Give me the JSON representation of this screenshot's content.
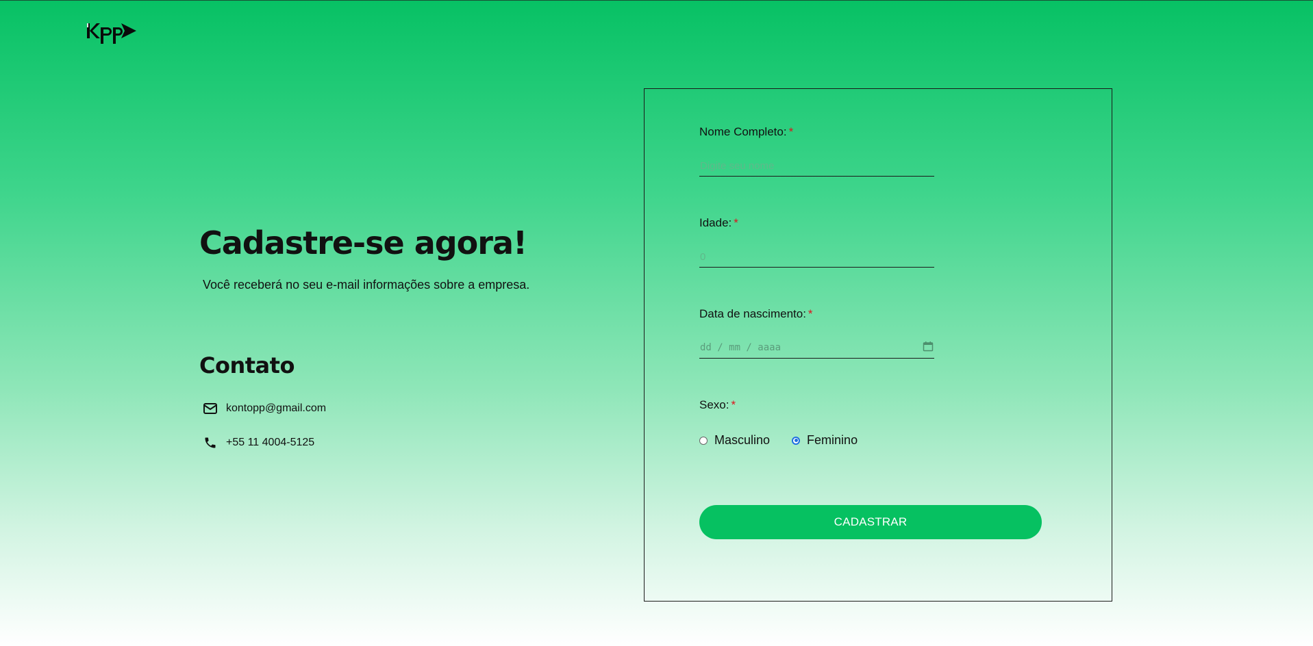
{
  "header": {
    "logo_text": "Kpp"
  },
  "hero": {
    "title": "Cadastre-se agora!",
    "subtitle": "Você receberá no seu e-mail informações sobre a empresa."
  },
  "contact": {
    "title": "Contato",
    "email": "kontopp@gmail.com",
    "phone": "+55 11 4004-5125"
  },
  "form": {
    "fields": {
      "nome": {
        "label": "Nome Completo:",
        "placeholder": "Digite seu nome"
      },
      "idade": {
        "label": "Idade:",
        "placeholder": "0"
      },
      "data": {
        "label": "Data de nascimento:",
        "placeholder": "dd / mm / aaaa"
      },
      "sexo": {
        "label": "Sexo:",
        "options": [
          "Masculino",
          "Feminino"
        ],
        "selected": "Feminino"
      }
    },
    "required_mark": "*",
    "submit_label": "CADASTRAR"
  },
  "icons": {
    "logo": "kpp-logo",
    "email": "envelope-icon",
    "phone": "phone-icon",
    "calendar": "calendar-icon"
  },
  "colors": {
    "brand_green": "#06c161",
    "required": "#e0121b",
    "radio_checked": "#1f6fe0"
  }
}
